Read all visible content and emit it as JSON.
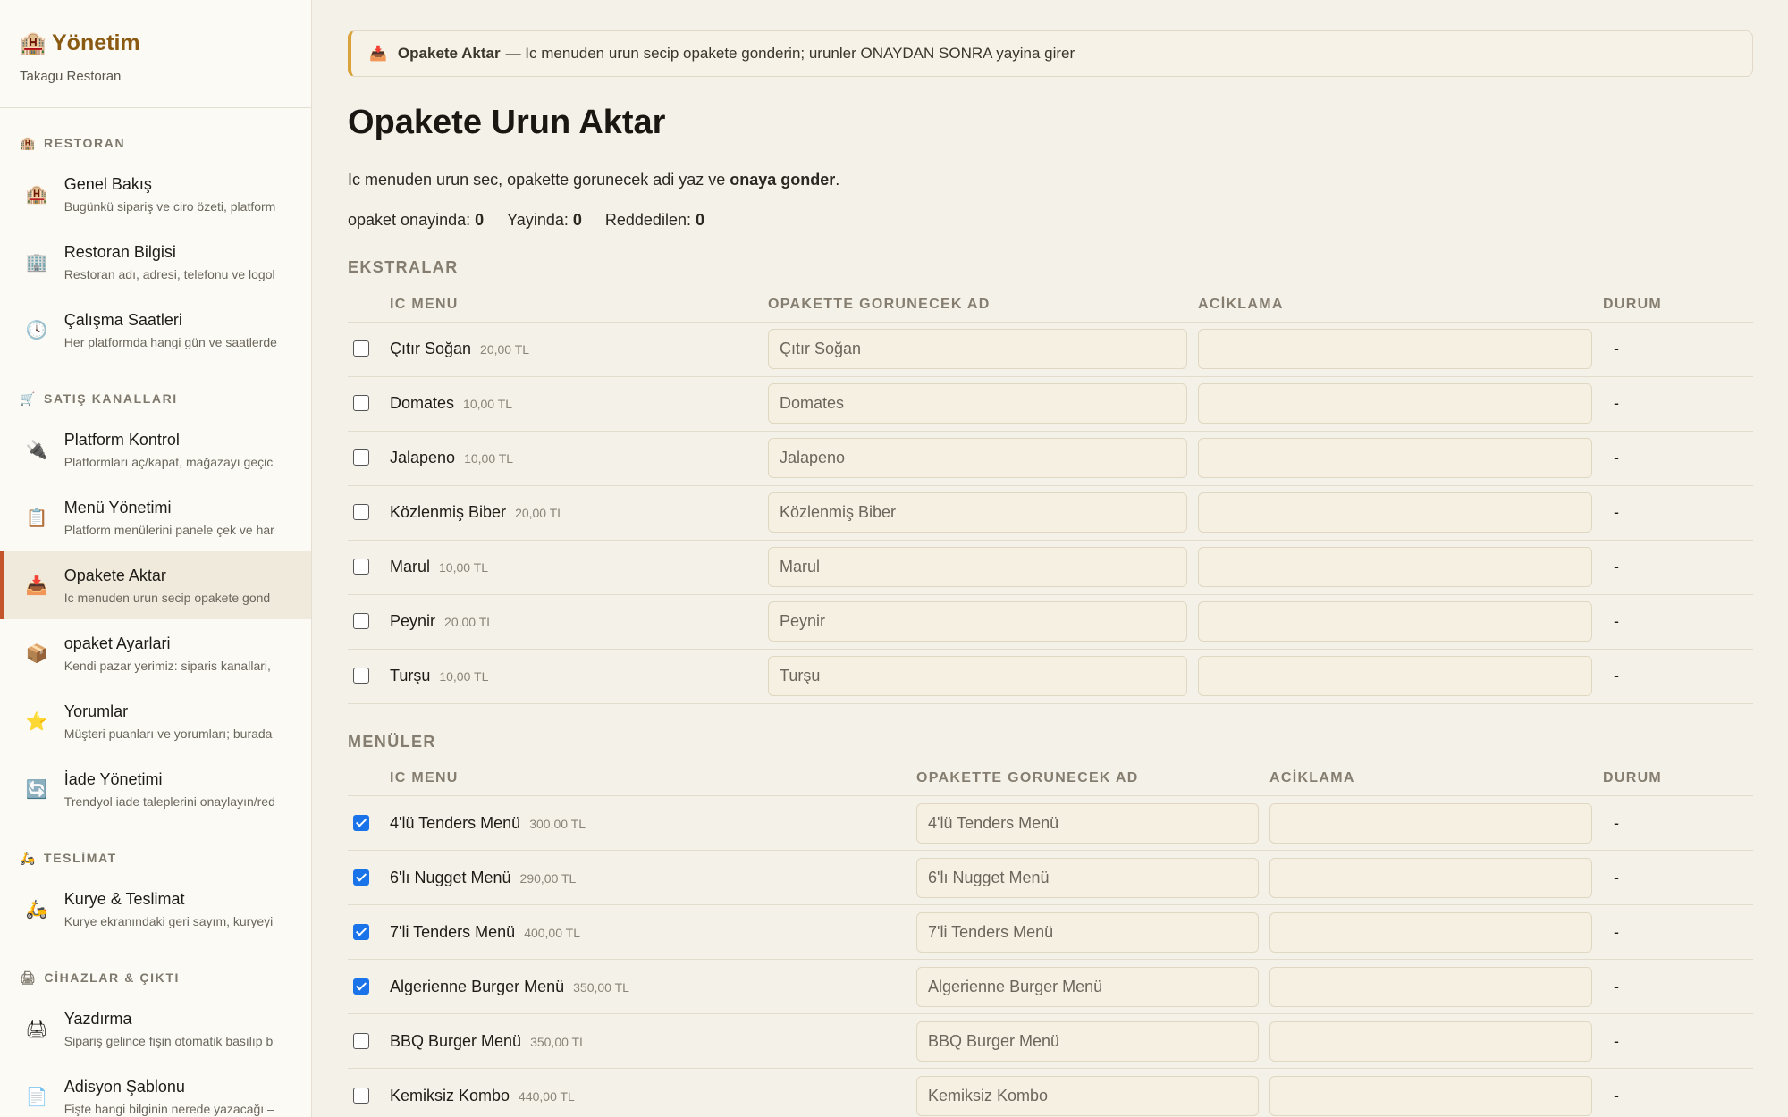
{
  "sidebar": {
    "brand_icon": "restaurant-building-icon",
    "brand_title": "Yönetim",
    "brand_sub": "Takagu Restoran",
    "sections": [
      {
        "title": "RESTORAN",
        "icon": "building-icon"
      },
      {
        "title": "SATIŞ KANALLARI",
        "icon": "cart-icon"
      },
      {
        "title": "TESLİMAT",
        "icon": "scooter-icon"
      },
      {
        "title": "CİHAZLAR & ÇIKTI",
        "icon": "printer-icon"
      }
    ],
    "items": [
      {
        "label": "Genel Bakış",
        "desc": "Bugünkü sipariş ve ciro özeti, platform",
        "icon": "building-icon"
      },
      {
        "label": "Restoran Bilgisi",
        "desc": "Restoran adı, adresi, telefonu ve logol",
        "icon": "office-icon"
      },
      {
        "label": "Çalışma Saatleri",
        "desc": "Her platformda hangi gün ve saatlerde",
        "icon": "clock-icon"
      },
      {
        "label": "Platform Kontrol",
        "desc": "Platformları aç/kapat, mağazayı geçic",
        "icon": "plug-icon"
      },
      {
        "label": "Menü Yönetimi",
        "desc": "Platform menülerini panele çek ve har",
        "icon": "menu-card-icon"
      },
      {
        "label": "Opakete Aktar",
        "desc": "Ic menuden urun secip opakete gond",
        "icon": "inbox-tray-icon"
      },
      {
        "label": "opaket Ayarlari",
        "desc": "Kendi pazar yerimiz: siparis kanallari,",
        "icon": "package-icon"
      },
      {
        "label": "Yorumlar",
        "desc": "Müşteri puanları ve yorumları; burada",
        "icon": "star-icon"
      },
      {
        "label": "İade Yönetimi",
        "desc": "Trendyol iade taleplerini onaylayın/red",
        "icon": "refresh-icon"
      },
      {
        "label": "Kurye & Teslimat",
        "desc": "Kurye ekranındaki geri sayım, kuryeyi",
        "icon": "scooter-icon"
      },
      {
        "label": "Yazdırma",
        "desc": "Sipariş gelince fişin otomatik basılıp b",
        "icon": "printer-icon"
      },
      {
        "label": "Adisyon Şablonu",
        "desc": "Fişte hangi bilginin nerede yazacağı –",
        "icon": "document-icon"
      }
    ]
  },
  "banner": {
    "icon": "inbox-tray-icon",
    "title": "Opakete Aktar",
    "text": "— Ic menuden urun secip opakete gonderin; urunler ONAYDAN SONRA yayina girer"
  },
  "page": {
    "title": "Opakete Urun Aktar",
    "intro_prefix": "Ic menuden urun sec, opakette gorunecek adi yaz ve ",
    "intro_bold": "onaya gonder",
    "intro_suffix": ".",
    "stats": [
      {
        "label": "opaket onayinda:",
        "value": "0"
      },
      {
        "label": "Yayinda:",
        "value": "0"
      },
      {
        "label": "Reddedilen:",
        "value": "0"
      }
    ]
  },
  "columns": {
    "ic_menu": "IC MENU",
    "opakette": "OPAKETTE GORUNECEK AD",
    "aciklama": "ACİKLAMA",
    "durum": "DURUM"
  },
  "groups": [
    {
      "title": "EKSTRALAR",
      "rows": [
        {
          "name": "Çıtır Soğan",
          "price": "20,00 TL",
          "display": "Çıtır Soğan",
          "desc": "",
          "status": "-",
          "checked": false
        },
        {
          "name": "Domates",
          "price": "10,00 TL",
          "display": "Domates",
          "desc": "",
          "status": "-",
          "checked": false
        },
        {
          "name": "Jalapeno",
          "price": "10,00 TL",
          "display": "Jalapeno",
          "desc": "",
          "status": "-",
          "checked": false
        },
        {
          "name": "Közlenmiş Biber",
          "price": "20,00 TL",
          "display": "Közlenmiş Biber",
          "desc": "",
          "status": "-",
          "checked": false
        },
        {
          "name": "Marul",
          "price": "10,00 TL",
          "display": "Marul",
          "desc": "",
          "status": "-",
          "checked": false
        },
        {
          "name": "Peynir",
          "price": "20,00 TL",
          "display": "Peynir",
          "desc": "",
          "status": "-",
          "checked": false
        },
        {
          "name": "Turşu",
          "price": "10,00 TL",
          "display": "Turşu",
          "desc": "",
          "status": "-",
          "checked": false
        }
      ]
    },
    {
      "title": "MENÜLER",
      "rows": [
        {
          "name": "4'lü Tenders Menü",
          "price": "300,00 TL",
          "display": "4'lü Tenders Menü",
          "desc": "",
          "status": "-",
          "checked": true
        },
        {
          "name": "6'lı Nugget Menü",
          "price": "290,00 TL",
          "display": "6'lı Nugget Menü",
          "desc": "",
          "status": "-",
          "checked": true
        },
        {
          "name": "7'li Tenders Menü",
          "price": "400,00 TL",
          "display": "7'li Tenders Menü",
          "desc": "",
          "status": "-",
          "checked": true
        },
        {
          "name": "Algerienne Burger Menü",
          "price": "350,00 TL",
          "display": "Algerienne Burger Menü",
          "desc": "",
          "status": "-",
          "checked": true
        },
        {
          "name": "BBQ Burger Menü",
          "price": "350,00 TL",
          "display": "BBQ Burger Menü",
          "desc": "",
          "status": "-",
          "checked": false
        },
        {
          "name": "Kemiksiz Kombo",
          "price": "440,00 TL",
          "display": "Kemiksiz Kombo",
          "desc": "",
          "status": "-",
          "checked": false
        }
      ]
    }
  ]
}
